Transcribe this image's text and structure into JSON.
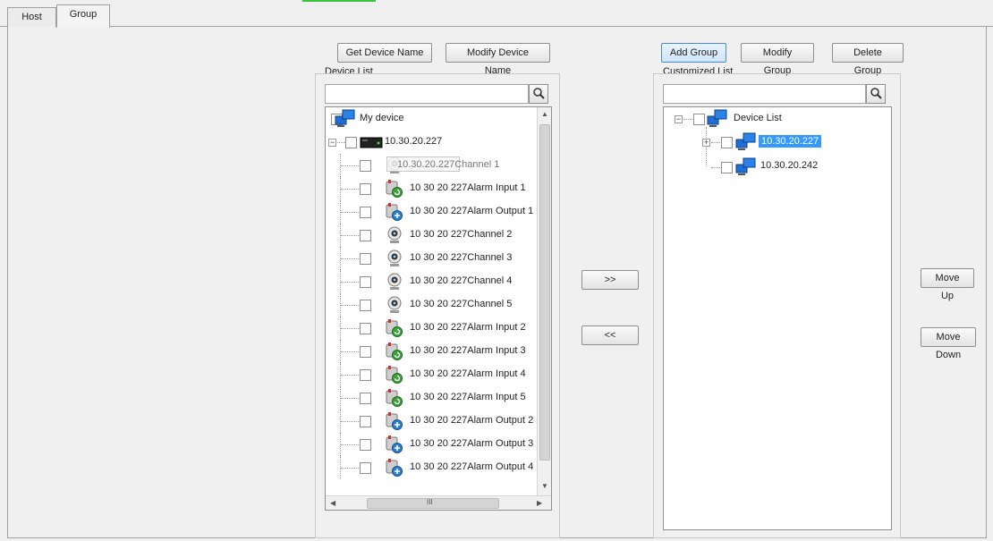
{
  "tabs": [
    {
      "label": "Host"
    },
    {
      "label": "Group"
    }
  ],
  "device_panel": {
    "get_name_button": "Get Device Name",
    "modify_name_button": "Modify Device Name",
    "list_label": "Device List",
    "search_value": "",
    "root_label": "My device",
    "device_label": "10.30.20.227",
    "tooltip_label": "10.30.20.227Channel 1",
    "items": [
      {
        "label": "10.30.20.227Channel 1",
        "icon": "camera-icon"
      },
      {
        "label": "10 30 20 227Alarm Input 1",
        "icon": "alarm-input-icon"
      },
      {
        "label": "10 30 20 227Alarm Output 1",
        "icon": "alarm-output-icon"
      },
      {
        "label": "10 30 20 227Channel 2",
        "icon": "camera-icon"
      },
      {
        "label": "10 30 20 227Channel 3",
        "icon": "camera-icon"
      },
      {
        "label": "10 30 20 227Channel 4",
        "icon": "camera-icon"
      },
      {
        "label": "10 30 20 227Channel 5",
        "icon": "camera-icon"
      },
      {
        "label": "10 30 20 227Alarm Input 2",
        "icon": "alarm-input-icon"
      },
      {
        "label": "10 30 20 227Alarm Input 3",
        "icon": "alarm-input-icon"
      },
      {
        "label": "10 30 20 227Alarm Input 4",
        "icon": "alarm-input-icon"
      },
      {
        "label": "10 30 20 227Alarm Input 5",
        "icon": "alarm-input-icon"
      },
      {
        "label": "10 30 20 227Alarm Output 2",
        "icon": "alarm-output-icon"
      },
      {
        "label": "10 30 20 227Alarm Output 3",
        "icon": "alarm-output-icon"
      },
      {
        "label": "10 30 20 227Alarm Output 4",
        "icon": "alarm-output-icon"
      }
    ],
    "hscroll_mark": "III"
  },
  "transfer": {
    "add_label": ">>",
    "remove_label": "<<"
  },
  "group_panel": {
    "add_button": "Add Group",
    "modify_button": "Modify Group",
    "delete_button": "Delete Group",
    "list_label": "Customized List",
    "search_value": "",
    "root_label": "Device List",
    "items": [
      {
        "label": "10.30.20.227",
        "selected": true
      },
      {
        "label": "10.30.20.242",
        "selected": false
      }
    ]
  },
  "order": {
    "up_label": "Move Up",
    "down_label": "Move Down"
  },
  "colors": {
    "selection": "#3399ff",
    "active_tab_indicator": "#3cc43c",
    "monitor_icon": "#1f6fd6"
  }
}
